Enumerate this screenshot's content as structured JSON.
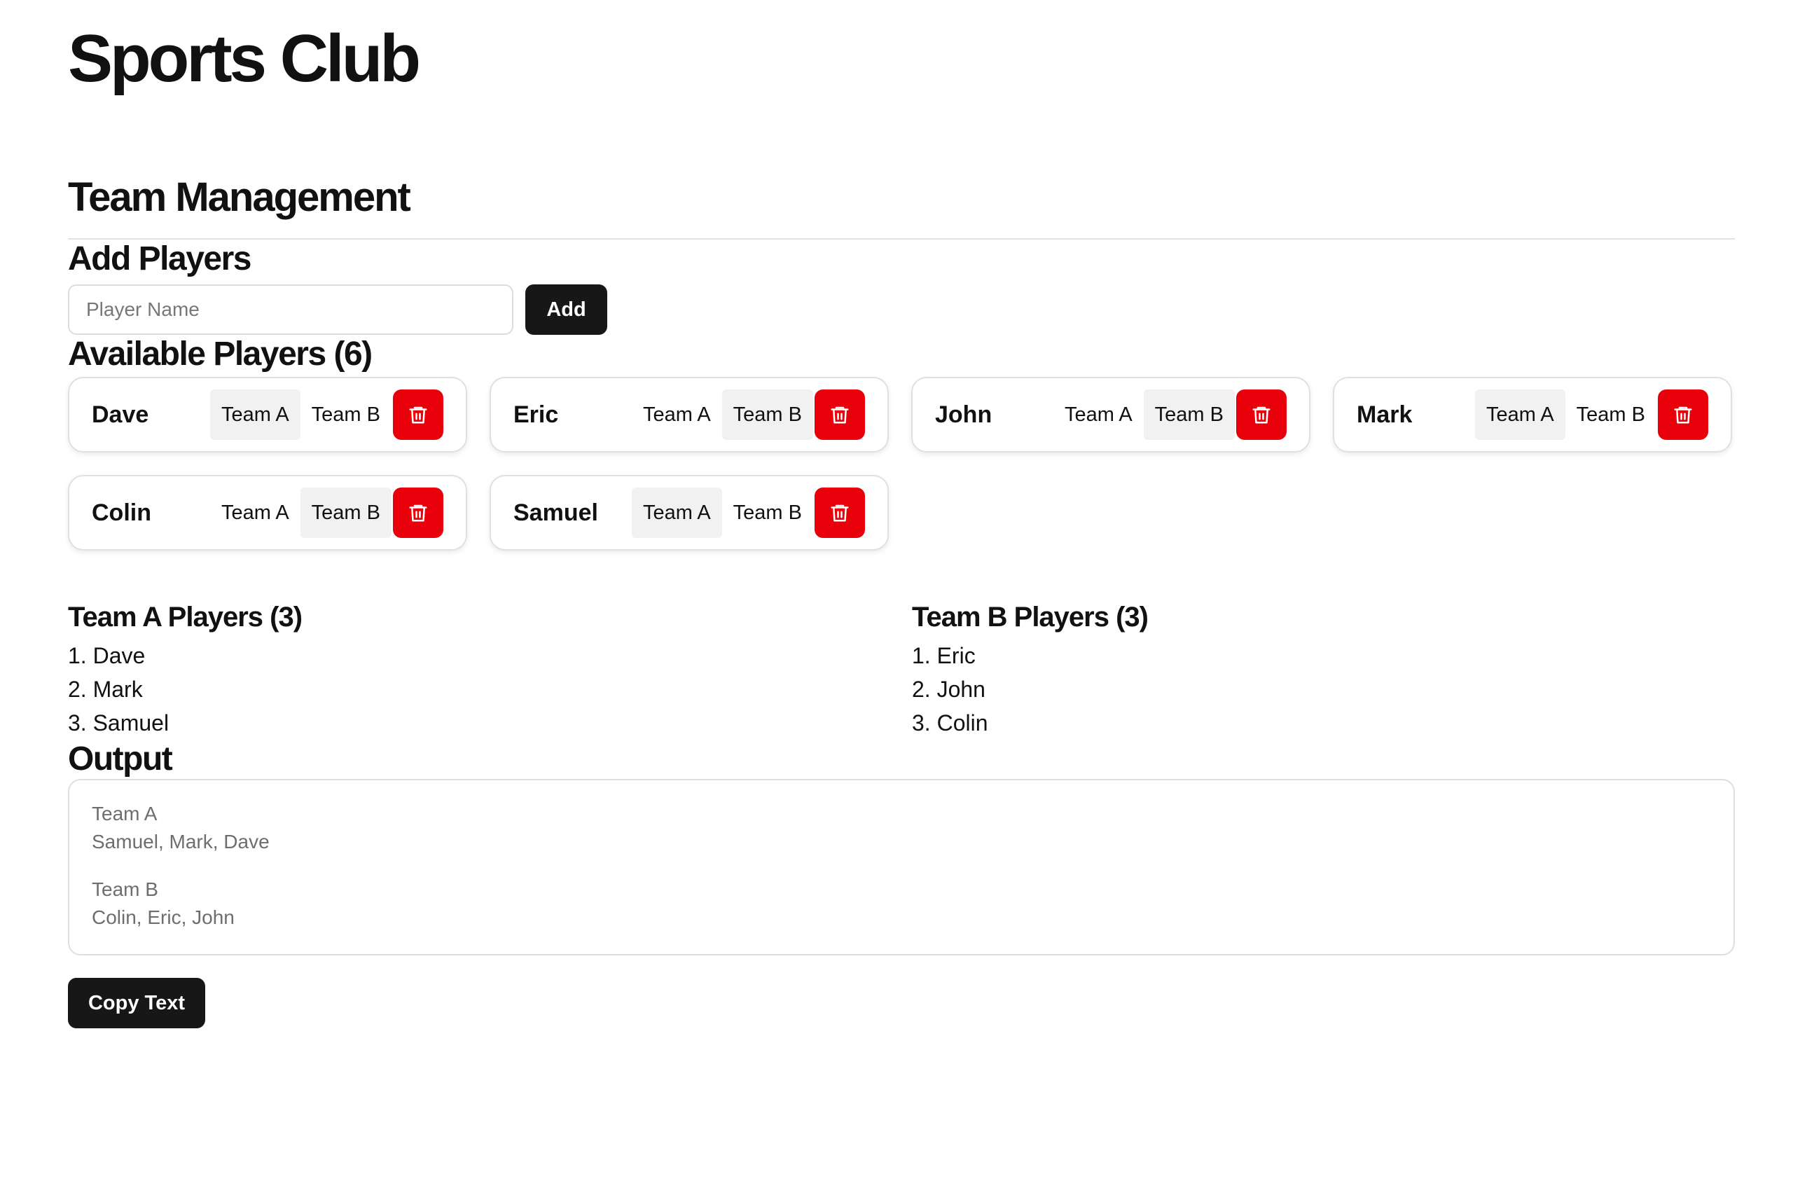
{
  "app": {
    "title": "Sports Club"
  },
  "section": {
    "title": "Team Management"
  },
  "add_players": {
    "title": "Add Players",
    "input_placeholder": "Player Name",
    "input_value": "",
    "add_label": "Add"
  },
  "available": {
    "title": "Available Players (6)",
    "team_a_label": "Team A",
    "team_b_label": "Team B",
    "players": [
      {
        "name": "Dave",
        "highlighted": "Team A"
      },
      {
        "name": "Eric",
        "highlighted": "Team B"
      },
      {
        "name": "John",
        "highlighted": "Team B"
      },
      {
        "name": "Mark",
        "highlighted": "Team A"
      },
      {
        "name": "Colin",
        "highlighted": "Team B"
      },
      {
        "name": "Samuel",
        "highlighted": "Team A"
      }
    ]
  },
  "team_a": {
    "title": "Team A Players (3)",
    "players": [
      "1. Dave",
      "2. Mark",
      "3. Samuel"
    ]
  },
  "team_b": {
    "title": "Team B Players (3)",
    "players": [
      "1. Eric",
      "2. John",
      "3. Colin"
    ]
  },
  "output": {
    "title": "Output",
    "team_a_heading": "Team A",
    "team_a_names": "Samuel, Mark, Dave",
    "team_b_heading": "Team B",
    "team_b_names": "Colin, Eric, John",
    "copy_label": "Copy Text"
  },
  "colors": {
    "delete": "#e8000b",
    "dark_button": "#171717",
    "selected_team": "#f1f1f1"
  },
  "icons": {
    "delete": "trash-icon"
  }
}
